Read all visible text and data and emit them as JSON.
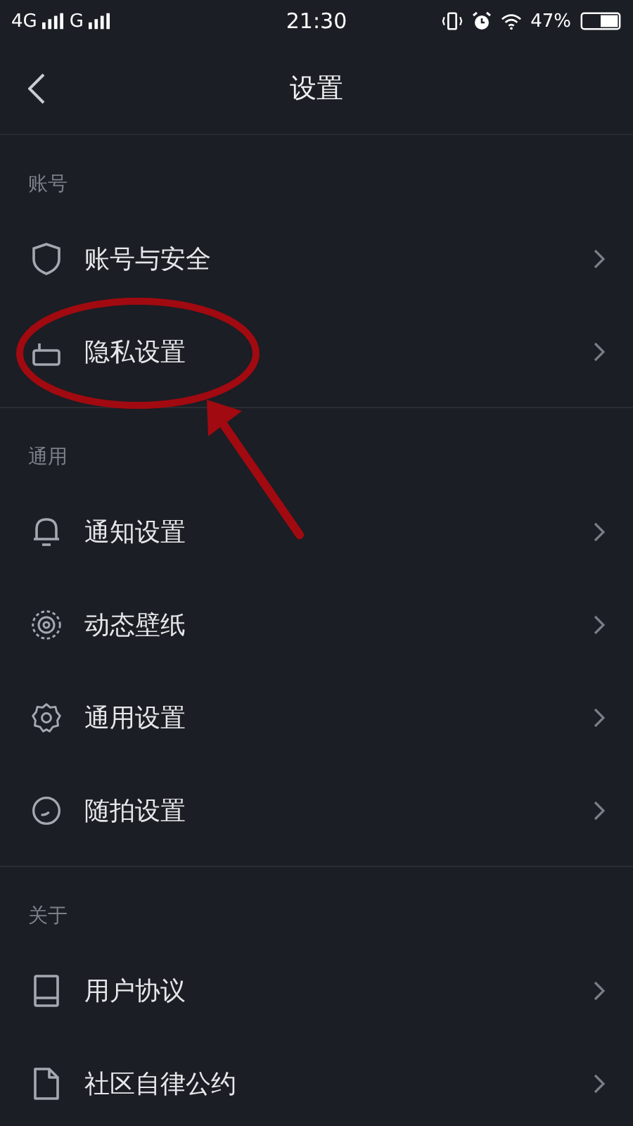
{
  "status_bar": {
    "network_1": "4G",
    "network_2": "G",
    "time": "21:30",
    "battery": "47%"
  },
  "header": {
    "title": "设置"
  },
  "sections": [
    {
      "label": "账号",
      "items": [
        {
          "label": "账号与安全"
        },
        {
          "label": "隐私设置"
        }
      ]
    },
    {
      "label": "通用",
      "items": [
        {
          "label": "通知设置"
        },
        {
          "label": "动态壁纸"
        },
        {
          "label": "通用设置"
        },
        {
          "label": "随拍设置"
        }
      ]
    },
    {
      "label": "关于",
      "items": [
        {
          "label": "用户协议"
        },
        {
          "label": "社区自律公约"
        }
      ]
    }
  ]
}
